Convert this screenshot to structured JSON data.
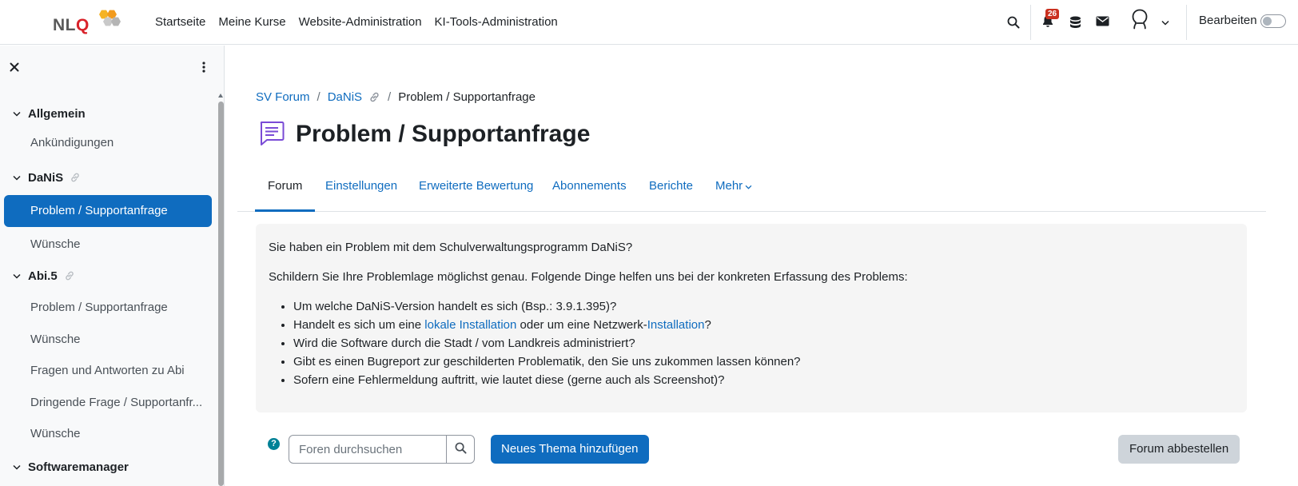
{
  "brand": {
    "logo_text": "NLQ",
    "logo_text_prefix": "NL",
    "logo_text_accent": "Q"
  },
  "primary_nav": [
    {
      "label": "Startseite"
    },
    {
      "label": "Meine Kurse"
    },
    {
      "label": "Website-Administration"
    },
    {
      "label": "KI-Tools-Administration"
    }
  ],
  "header": {
    "notification_count": "26",
    "edit_mode_label": "Bearbeiten",
    "edit_mode_on": false
  },
  "sidebar": {
    "sections": [
      {
        "label": "Allgemein",
        "items": [
          "Ankündigungen"
        ]
      },
      {
        "label": "DaNiS",
        "items": [
          "Problem / Supportanfrage",
          "Wünsche"
        ],
        "active_item": "Problem / Supportanfrage"
      },
      {
        "label": "Abi.5",
        "items": [
          "Problem / Supportanfrage",
          "Wünsche",
          "Fragen und Antworten zu Abi",
          "Dringende Frage / Supportanfr...",
          "Wünsche"
        ]
      },
      {
        "label": "Softwaremanager",
        "items": []
      }
    ]
  },
  "breadcrumb": [
    {
      "label": "SV Forum"
    },
    {
      "label": "DaNiS"
    },
    {
      "label": "Problem / Supportanfrage"
    }
  ],
  "page": {
    "title": "Problem / Supportanfrage"
  },
  "tabs": [
    {
      "label": "Forum",
      "active": true
    },
    {
      "label": "Einstellungen"
    },
    {
      "label": "Erweiterte Bewertung"
    },
    {
      "label": "Abonnements"
    },
    {
      "label": "Berichte"
    },
    {
      "label": "Mehr"
    }
  ],
  "intro": {
    "p1": "Sie haben ein Problem mit dem Schulverwaltungsprogramm DaNiS?",
    "p2": "Schildern Sie Ihre Problemlage möglichst genau. Folgende Dinge helfen uns bei der konkreten Erfassung des Problems:",
    "li1": "Um welche DaNiS-Version handelt es sich (Bsp.: 3.9.1.395)?",
    "li2_a": "Handelt es sich um eine ",
    "li2_link1": "lokale Installation",
    "li2_b": " oder um eine Netzwerk-",
    "li2_link2": "Installation",
    "li2_c": "?",
    "li3": "Wird die Software durch die Stadt / vom Landkreis administriert?",
    "li4": "Gibt es einen Bugreport zur geschilderten Problematik, den Sie uns zukommen lassen können?",
    "li5": "Sofern eine Fehlermeldung auftritt, wie lautet diese (gerne auch als Screenshot)?"
  },
  "actions": {
    "help_glyph": "?",
    "search_placeholder": "Foren durchsuchen",
    "add_topic": "Neues Thema hinzufügen",
    "unsubscribe": "Forum abbestellen"
  },
  "colors": {
    "primary": "#0f6cbf",
    "badge": "#ca3120",
    "help": "#008196",
    "logo_accent": "#d9222a"
  },
  "icons": [
    "logo-hexagons-icon",
    "search-icon",
    "bell-icon",
    "database-icon",
    "envelope-icon",
    "user-avatar-icon",
    "chevron-down-icon",
    "close-icon",
    "kebab-icon",
    "link-icon",
    "forum-icon",
    "question-icon"
  ]
}
